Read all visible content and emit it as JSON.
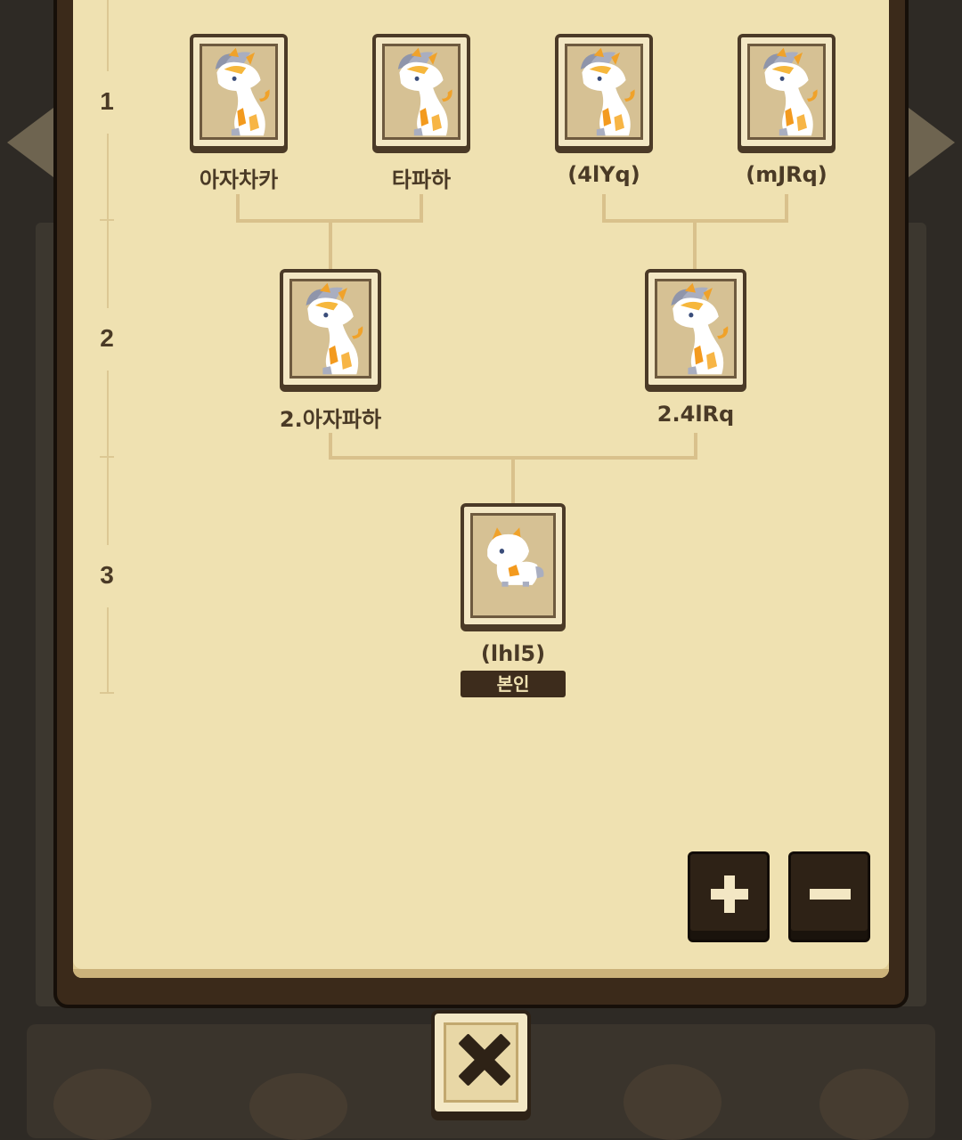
{
  "generations": [
    "1",
    "2",
    "3"
  ],
  "tree": {
    "gen1": [
      {
        "name": "아자차카"
      },
      {
        "name": "타파하"
      },
      {
        "name": "(4lYq)"
      },
      {
        "name": "(mJRq)"
      }
    ],
    "gen2": [
      {
        "name": "2.아자파하"
      },
      {
        "name": "2.4lRq"
      }
    ],
    "gen3": {
      "name": "(lhl5)",
      "badge": "본인"
    }
  },
  "icons": {
    "adult_dragon": "adult-dragon-portrait-icon",
    "baby_dragon": "baby-dragon-portrait-icon",
    "zoom_in": "plus-icon",
    "zoom_out": "minus-icon",
    "close": "close-icon"
  },
  "colors": {
    "paper": "#efe1b1",
    "frame": "#3b2a1a",
    "text": "#4a3a26",
    "connector": "#d9c18c"
  }
}
